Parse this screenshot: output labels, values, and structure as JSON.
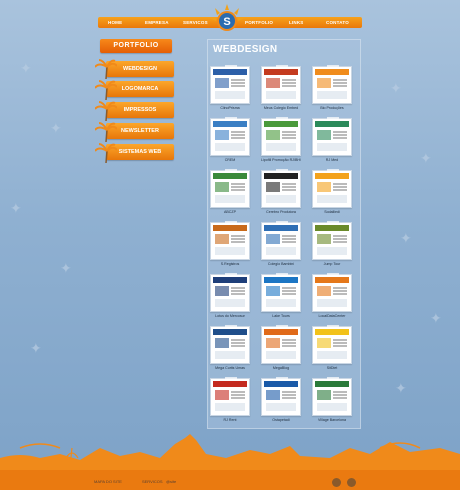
{
  "nav": {
    "items": [
      {
        "label": "HOME"
      },
      {
        "label": "EMPRESA"
      },
      {
        "label": "SERVICOS"
      },
      {
        "label": "PORTFOLIO"
      },
      {
        "label": "LINKS"
      },
      {
        "label": "CONTATO"
      }
    ]
  },
  "sidebar": {
    "header": "PORTFOLIO",
    "items": [
      {
        "label": "WEBDESIGN"
      },
      {
        "label": "LOGOMARCA"
      },
      {
        "label": "IMPRESSOS"
      },
      {
        "label": "NEWSLETTER"
      },
      {
        "label": "SISTEMAS WEB"
      }
    ]
  },
  "main": {
    "title": "WEBDESIGN",
    "thumbnails": [
      {
        "caption": "ClinoPrisma",
        "accent": "#2c5fa8"
      },
      {
        "caption": "Meus Colegio Embed",
        "accent": "#c43b1f"
      },
      {
        "caption": "Bio Produções",
        "accent": "#f08c1c"
      },
      {
        "caption": "CREM",
        "accent": "#3b7fc4"
      },
      {
        "caption": "Lipofill Promoção RJ/BH/SP",
        "accent": "#4a9a3b"
      },
      {
        "caption": "RJ Med",
        "accent": "#2b8a5a"
      },
      {
        "caption": "ABCZP",
        "accent": "#3a8a3a"
      },
      {
        "caption": "Cerebro Produtora",
        "accent": "#222222"
      },
      {
        "caption": "Sodalliedi",
        "accent": "#f3a21c"
      },
      {
        "caption": "S.Registros",
        "accent": "#c96a1a"
      },
      {
        "caption": "Colegio Bambini",
        "accent": "#2f6fb5"
      },
      {
        "caption": "Jump Tour",
        "accent": "#6a8a2a"
      },
      {
        "caption": "Lotus do Mercosur",
        "accent": "#1e3f7a"
      },
      {
        "caption": "Lake Tours",
        "accent": "#1c76c4"
      },
      {
        "caption": "LocalDataCenter",
        "accent": "#e5781a"
      },
      {
        "caption": "Mega Curtis Umas",
        "accent": "#1f4e8a"
      },
      {
        "caption": "MegaBlog",
        "accent": "#e06a1a"
      },
      {
        "caption": "SitDiet",
        "accent": "#f2c21a"
      },
      {
        "caption": "RJ Rent",
        "accent": "#c42a1f"
      },
      {
        "caption": "Ostapetadi",
        "accent": "#1a5aa8"
      },
      {
        "caption": "Village Barcelona",
        "accent": "#2a7a3a"
      }
    ]
  },
  "footer": {
    "links": [
      "MAPA DO SITE",
      "SERVICOS"
    ],
    "copyright": "@site"
  },
  "colors": {
    "accent": "#f08a1a",
    "background": "#8fb0d1",
    "skyline": "#f08a1a"
  }
}
